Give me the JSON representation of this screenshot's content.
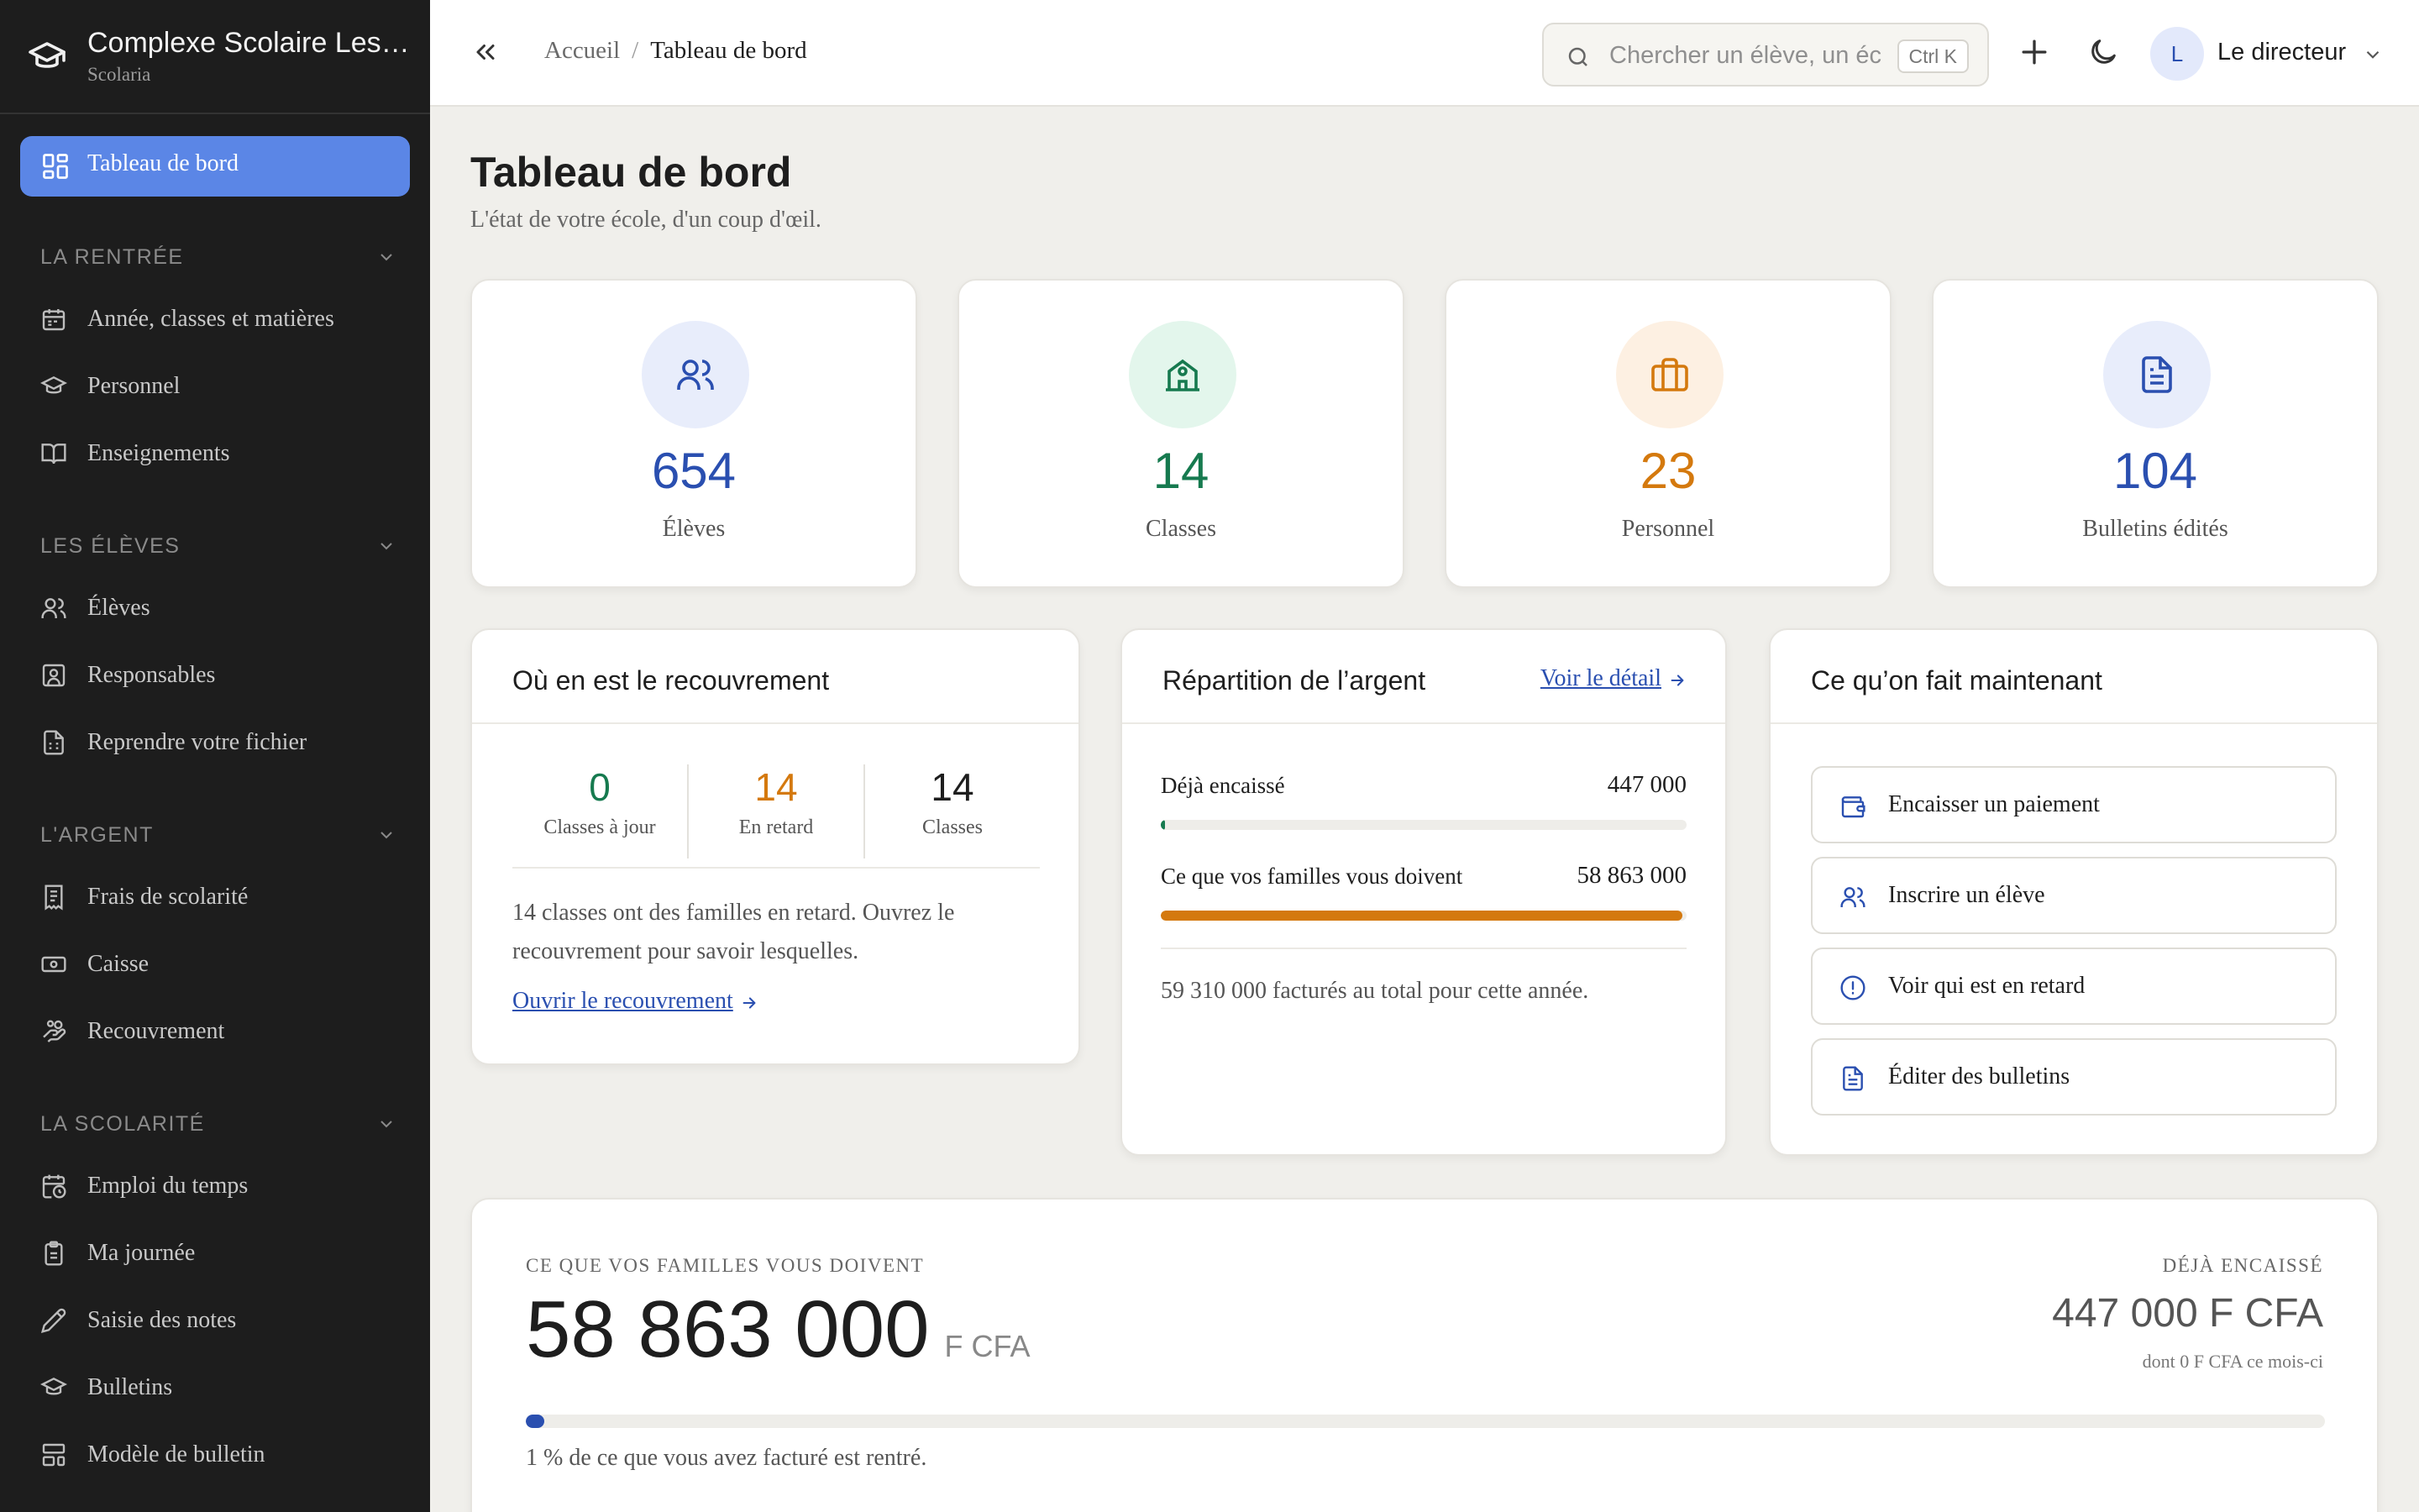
{
  "colors": {
    "accent": "#5b86e6",
    "blue": "#2a4fb0",
    "green": "#167a4f",
    "orange": "#d4790e",
    "sidebar_bg": "#1d1d1d",
    "page_bg": "#f0efeb"
  },
  "sidebar": {
    "school_name": "Complexe Scolaire Les …",
    "app_name": "Scolaria",
    "active_item": {
      "label": "Tableau de bord",
      "icon": "dashboard-icon"
    },
    "sections": [
      {
        "title": "LA RENTRÉE",
        "items": [
          {
            "label": "Année, classes et matières",
            "icon": "calendar-icon"
          },
          {
            "label": "Personnel",
            "icon": "graduation-cap-icon"
          },
          {
            "label": "Enseignements",
            "icon": "book-open-icon"
          }
        ]
      },
      {
        "title": "LES ÉLÈVES",
        "items": [
          {
            "label": "Élèves",
            "icon": "users-icon"
          },
          {
            "label": "Responsables",
            "icon": "contact-card-icon"
          },
          {
            "label": "Reprendre votre fichier",
            "icon": "file-spreadsheet-icon"
          }
        ]
      },
      {
        "title": "L'ARGENT",
        "items": [
          {
            "label": "Frais de scolarité",
            "icon": "receipt-icon"
          },
          {
            "label": "Caisse",
            "icon": "banknote-icon"
          },
          {
            "label": "Recouvrement",
            "icon": "hand-coins-icon"
          }
        ]
      },
      {
        "title": "LA SCOLARITÉ",
        "items": [
          {
            "label": "Emploi du temps",
            "icon": "calendar-clock-icon"
          },
          {
            "label": "Ma journée",
            "icon": "clipboard-icon"
          },
          {
            "label": "Saisie des notes",
            "icon": "pencil-icon"
          },
          {
            "label": "Bulletins",
            "icon": "graduation-cap-icon"
          },
          {
            "label": "Modèle de bulletin",
            "icon": "layout-template-icon"
          }
        ]
      }
    ]
  },
  "header": {
    "breadcrumb": [
      "Accueil",
      "Tableau de bord"
    ],
    "search_placeholder": "Chercher un élève, un éc",
    "search_shortcut": "Ctrl K",
    "avatar_initial": "L",
    "user_name": "Le directeur"
  },
  "page": {
    "title": "Tableau de bord",
    "subtitle": "L'état de votre école, d'un coup d'œil."
  },
  "stats": [
    {
      "value": "654",
      "label": "Élèves",
      "icon": "users-icon",
      "color": "#2a4fb0",
      "bg": "#e8edfb"
    },
    {
      "value": "14",
      "label": "Classes",
      "icon": "school-icon",
      "color": "#167a4f",
      "bg": "#e3f6ec"
    },
    {
      "value": "23",
      "label": "Personnel",
      "icon": "briefcase-icon",
      "color": "#d4790e",
      "bg": "#fdf0e2"
    },
    {
      "value": "104",
      "label": "Bulletins édités",
      "icon": "document-icon",
      "color": "#2a4fb0",
      "bg": "#e8edfb"
    }
  ],
  "recouvrement": {
    "title": "Où en est le recouvrement",
    "stats": [
      {
        "value": "0",
        "label": "Classes à jour",
        "color": "#167a4f"
      },
      {
        "value": "14",
        "label": "En retard",
        "color": "#d4790e"
      },
      {
        "value": "14",
        "label": "Classes",
        "color": "#1e1e1e"
      }
    ],
    "text": "14 classes ont des familles en retard. Ouvrez le recouvrement pour savoir lesquelles.",
    "link": "Ouvrir le recouvrement"
  },
  "repartition": {
    "title": "Répartition de l’argent",
    "link": "Voir le détail",
    "rows": [
      {
        "label": "Déjà encaissé",
        "value": "447 000",
        "fraction": 0.0075,
        "color": "#167a4f"
      },
      {
        "label": "Ce que vos familles vous doivent",
        "value": "58 863 000",
        "fraction": 0.9925,
        "color": "#d4790e"
      }
    ],
    "footer": "59 310 000 facturés au total pour cette année."
  },
  "actions": {
    "title": "Ce qu’on fait maintenant",
    "items": [
      {
        "label": "Encaisser un paiement",
        "icon": "wallet-icon"
      },
      {
        "label": "Inscrire un élève",
        "icon": "users-icon"
      },
      {
        "label": "Voir qui est en retard",
        "icon": "alert-circle-icon"
      },
      {
        "label": "Éditer des bulletins",
        "icon": "document-icon"
      }
    ]
  },
  "summary": {
    "owed_label": "CE QUE VOS FAMILLES VOUS DOIVENT",
    "owed_value": "58 863 000",
    "owed_unit": "F CFA",
    "collected_label": "DÉJÀ ENCAISSÉ",
    "collected_value": "447 000 F CFA",
    "collected_note": "dont 0 F CFA ce mois-ci",
    "progress_fraction": 0.0075,
    "progress_text": "1 % de ce que vous avez facturé est rentré."
  }
}
